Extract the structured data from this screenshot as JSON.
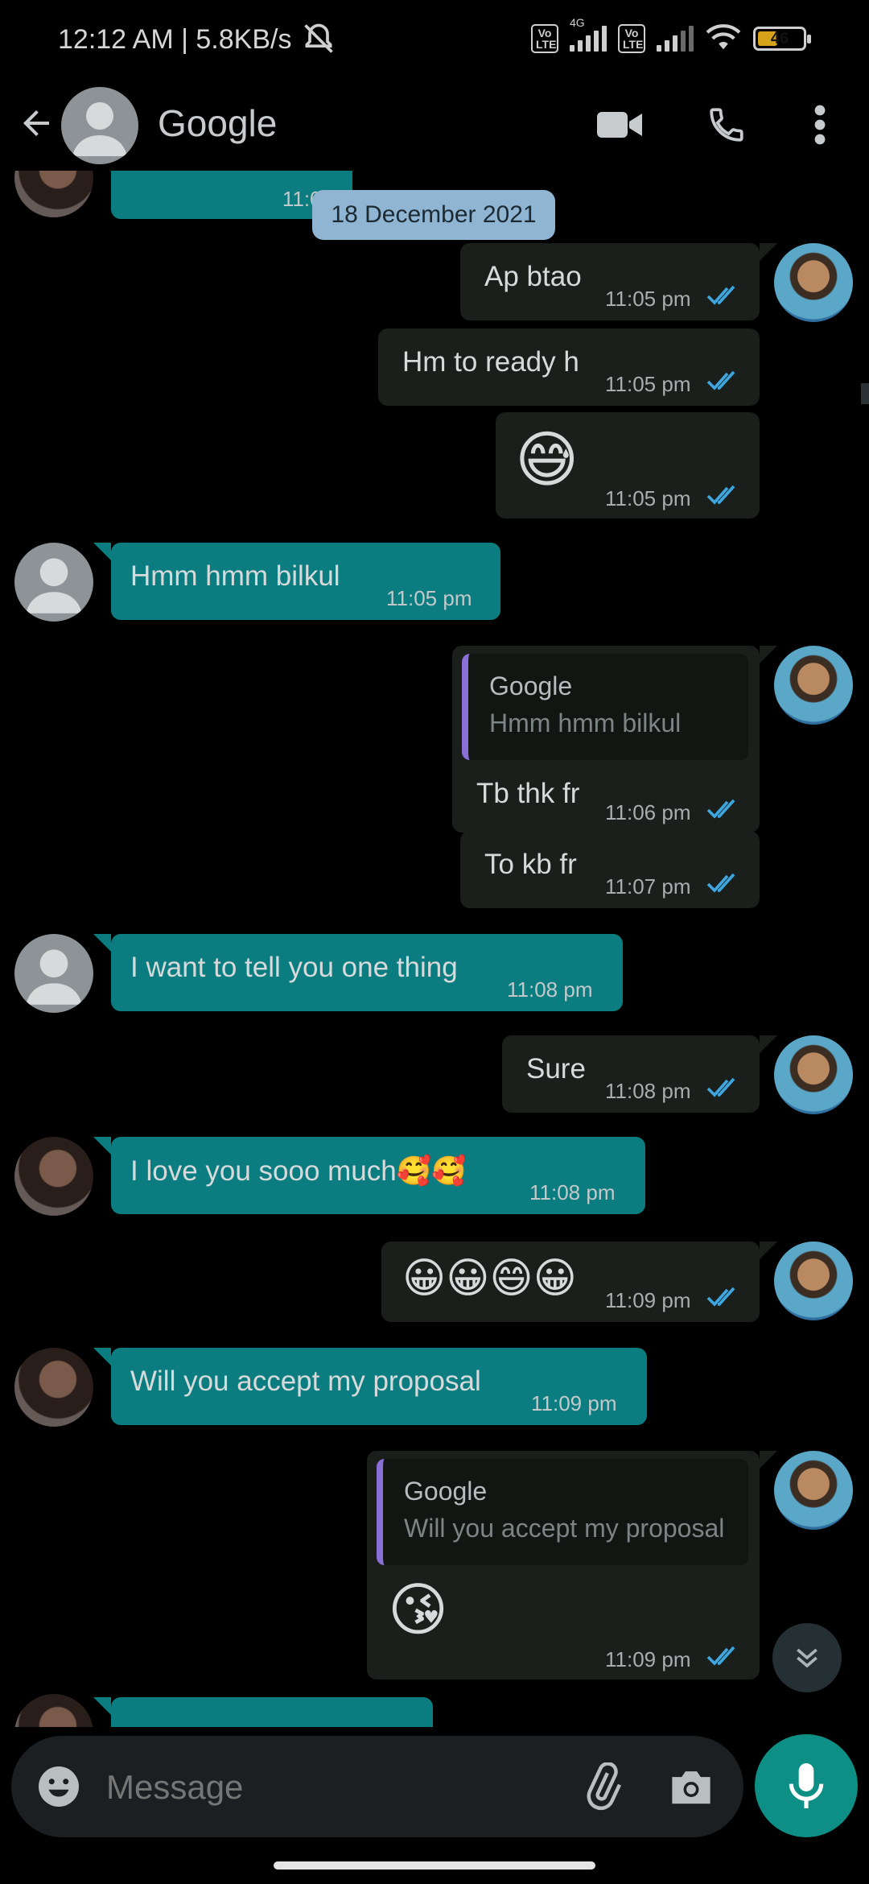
{
  "status_bar": {
    "time": "12:12 AM | 5.8KB/s",
    "network_label": "4G",
    "volte_label": "Vo\nLTE",
    "battery": "46"
  },
  "header": {
    "contact_name": "Google"
  },
  "date_chip": "18 December 2021",
  "partial_top_time": "11:04",
  "messages": [
    {
      "text": "Ap btao",
      "time": "11:05 pm"
    },
    {
      "text": "Hm to ready h",
      "time": "11:05 pm"
    },
    {
      "text": "😅",
      "time": "11:05 pm"
    },
    {
      "text": "Hmm hmm bilkul",
      "time": "11:05 pm"
    },
    {
      "quote_name": "Google",
      "quote_text": "Hmm hmm bilkul",
      "text": "Tb thk fr",
      "time": "11:06 pm"
    },
    {
      "text": "To kb fr",
      "time": "11:07 pm"
    },
    {
      "text": "I want to tell you one thing",
      "time": "11:08 pm"
    },
    {
      "text": "Sure",
      "time": "11:08 pm"
    },
    {
      "text": "I love you sooo much🥰🥰",
      "time": "11:08 pm"
    },
    {
      "text": "😀😀😄😀",
      "time": "11:09 pm"
    },
    {
      "text": "Will you accept my proposal",
      "time": "11:09 pm"
    },
    {
      "quote_name": "Google",
      "quote_text": "Will you accept my proposal",
      "text": "😘",
      "time": "11:09 pm"
    }
  ],
  "input": {
    "placeholder": "Message"
  },
  "colors": {
    "incoming": "#0b7d80",
    "outgoing": "#1a1f1c",
    "tick": "#3fa7e0",
    "mic": "#0e8f85"
  }
}
